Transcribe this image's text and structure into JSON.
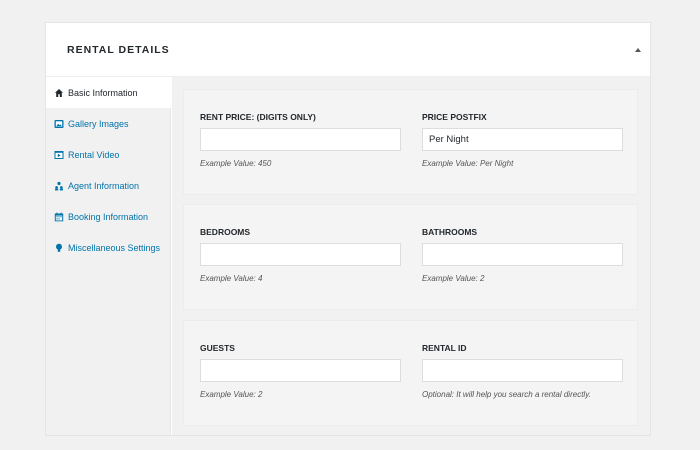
{
  "metabox": {
    "title": "RENTAL DETAILS"
  },
  "tabs": [
    {
      "label": "Basic Information",
      "icon": "home-icon",
      "active": true
    },
    {
      "label": "Gallery Images",
      "icon": "images-icon",
      "active": false
    },
    {
      "label": "Rental Video",
      "icon": "video-icon",
      "active": false
    },
    {
      "label": "Agent Information",
      "icon": "users-icon",
      "active": false
    },
    {
      "label": "Booking Information",
      "icon": "calendar-icon",
      "active": false
    },
    {
      "label": "Miscellaneous Settings",
      "icon": "lightbulb-icon",
      "active": false
    }
  ],
  "fields": {
    "rent_price": {
      "label": "RENT PRICE: (DIGITS ONLY)",
      "value": "",
      "hint": "Example Value: 450"
    },
    "price_postfix": {
      "label": "PRICE POSTFIX",
      "value": "Per Night",
      "hint": "Example Value: Per Night"
    },
    "bedrooms": {
      "label": "BEDROOMS",
      "value": "",
      "hint": "Example Value: 4"
    },
    "bathrooms": {
      "label": "BATHROOMS",
      "value": "",
      "hint": "Example Value: 2"
    },
    "guests": {
      "label": "GUESTS",
      "value": "",
      "hint": "Example Value: 2"
    },
    "rental_id": {
      "label": "RENTAL ID",
      "value": "",
      "hint": "Optional: It will help you search a rental directly."
    }
  },
  "colors": {
    "link": "#0073aa",
    "text": "#23282d",
    "background": "#f1f1f1"
  }
}
